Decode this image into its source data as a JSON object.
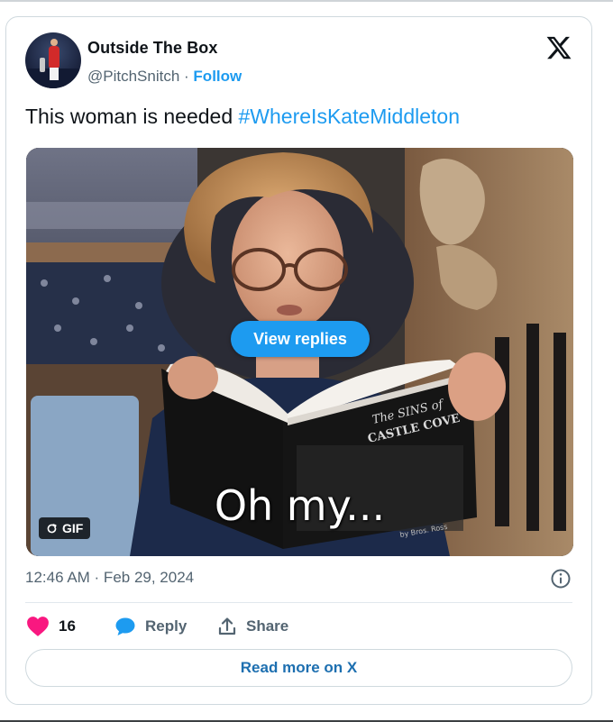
{
  "tweet": {
    "author": {
      "display_name": "Outside The Box",
      "handle": "@PitchSnitch",
      "separator": " · ",
      "follow_label": "Follow",
      "avatar_icon": "avatar-football-player"
    },
    "text": "This woman is needed ",
    "hashtag": "#WhereIsKateMiddleton",
    "media": {
      "type": "gif",
      "view_replies_label": "View replies",
      "caption": "Oh my...",
      "book_title_line1": "The SINS of",
      "book_title_line2": "CASTLE COVE",
      "book_author": "by Bros. Ross",
      "badge_label": "GIF",
      "badge_icon": "refresh-icon"
    },
    "timestamp": "12:46 AM · Feb 29, 2024",
    "actions": {
      "like_count": "16",
      "reply_label": "Reply",
      "share_label": "Share"
    },
    "read_more_label": "Read more on X"
  },
  "colors": {
    "accent": "#1d9bf0",
    "like": "#f91880",
    "secondary_text": "#536471",
    "primary_text": "#0f1419",
    "border": "#cfd9de"
  }
}
